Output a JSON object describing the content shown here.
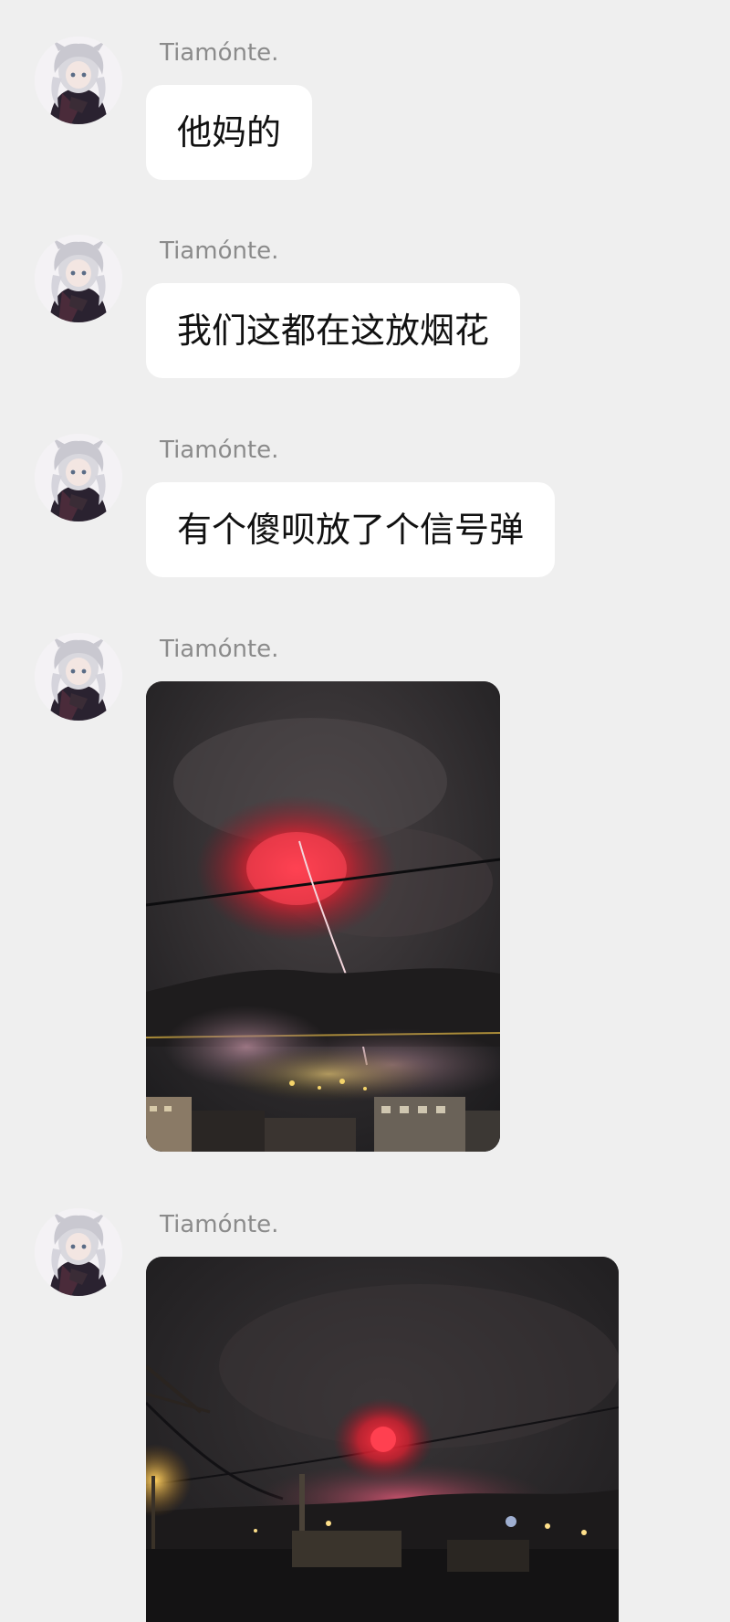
{
  "messages": [
    {
      "sender": "Tiamónte.",
      "type": "text",
      "text": "他妈的"
    },
    {
      "sender": "Tiamónte.",
      "type": "text",
      "text": "我们这都在这放烟花"
    },
    {
      "sender": "Tiamónte.",
      "type": "text",
      "text": "有个傻呗放了个信号弹"
    },
    {
      "sender": "Tiamónte.",
      "type": "image",
      "image": "night-photo-red-signal-flare"
    },
    {
      "sender": "Tiamónte.",
      "type": "image",
      "image": "night-photo-red-flare-distant"
    }
  ],
  "colors": {
    "background": "#efefef",
    "bubble": "#ffffff",
    "sender_name": "#8b8b8b"
  }
}
